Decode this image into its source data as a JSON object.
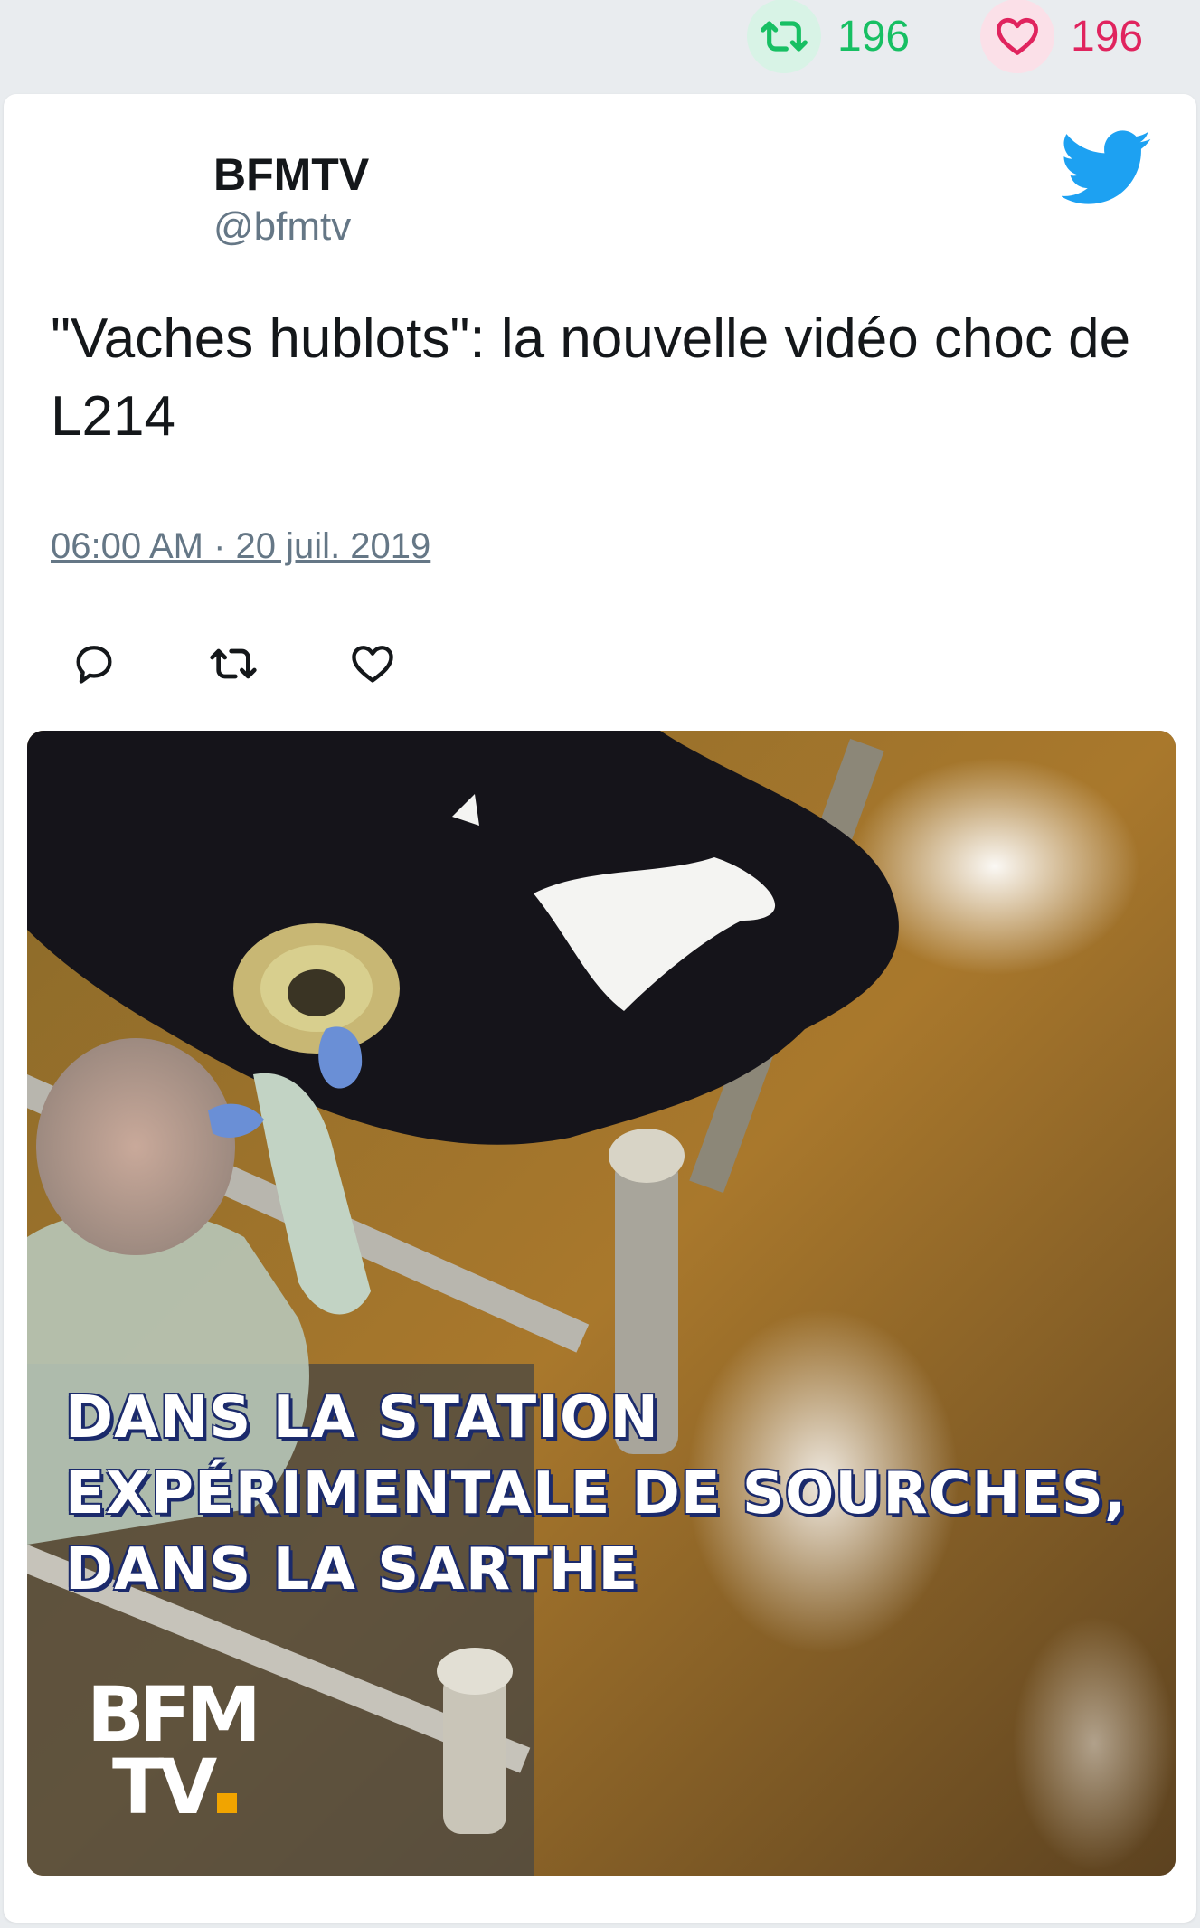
{
  "stats": {
    "retweet_count": "196",
    "like_count": "196"
  },
  "tweet": {
    "author_name": "BFMTV",
    "author_handle": "@bfmtv",
    "text": "\"Vaches hublots\": la nouvelle vidéo choc de L214",
    "timestamp": "06:00 AM · 20 juil. 2019"
  },
  "media": {
    "caption_lines": [
      "DANS LA STATION",
      "EXPÉRIMENTALE DE SOURCHES,",
      "DANS LA SARTHE"
    ],
    "logo": {
      "line1": "BFM",
      "line2": "TV"
    }
  },
  "icons": {
    "stats_retweet": "retweet-icon",
    "stats_like": "heart-icon",
    "brand": "twitter-bird-icon",
    "reply": "reply-icon",
    "retweet": "retweet-icon",
    "like": "heart-icon"
  },
  "colors": {
    "retweet_green": "#17bf63",
    "like_red": "#e0245e",
    "twitter_blue": "#1da1f2",
    "secondary_text": "#657786"
  }
}
